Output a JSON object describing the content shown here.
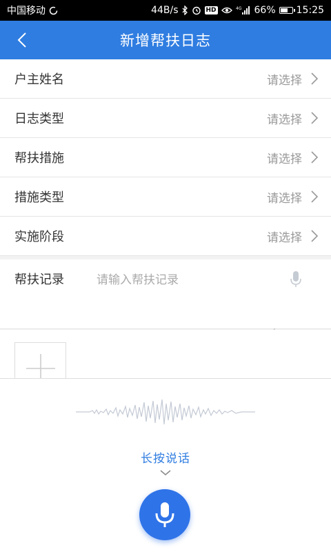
{
  "status_bar": {
    "carrier": "中国移动",
    "net_speed": "44B/s",
    "hd": "HD",
    "network": "4G",
    "battery_text": "66%",
    "battery_level": 0.66,
    "time": "15:25"
  },
  "header": {
    "title": "新增帮扶日志"
  },
  "form": {
    "rows": [
      {
        "label": "户主姓名",
        "value": "请选择"
      },
      {
        "label": "日志类型",
        "value": "请选择"
      },
      {
        "label": "帮扶措施",
        "value": "请选择"
      },
      {
        "label": "措施类型",
        "value": "请选择"
      },
      {
        "label": "实施阶段",
        "value": "请选择"
      }
    ],
    "record": {
      "label": "帮扶记录",
      "placeholder": "请输入帮扶记录"
    }
  },
  "voice": {
    "hint": "长按说话"
  },
  "colors": {
    "primary": "#2f7de1",
    "mic_button": "#2f73e8"
  }
}
